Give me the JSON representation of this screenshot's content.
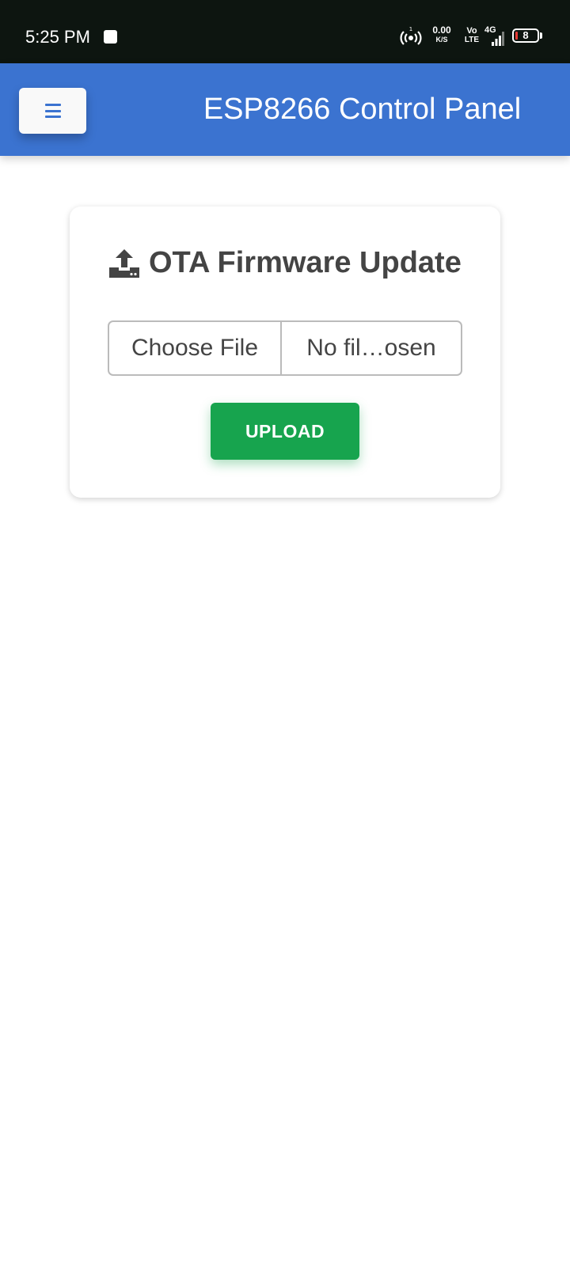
{
  "status_bar": {
    "time": "5:25 PM",
    "net_speed_value": "0.00",
    "net_speed_unit": "K/S",
    "volte_top": "Vo",
    "volte_bottom": "LTE",
    "network_type": "4G",
    "hotspot_badge": "1",
    "battery_level": "8",
    "battery_color": "#e53935"
  },
  "header": {
    "title": "ESP8266 Control Panel",
    "menu_icon": "hamburger-icon",
    "background": "#3b73d0"
  },
  "ota_card": {
    "icon": "upload-icon",
    "title": "OTA Firmware Update",
    "file_input": {
      "button_label": "Choose File",
      "status": "No fil…osen"
    },
    "upload_button_label": "UPLOAD",
    "upload_button_color": "#17a44e"
  }
}
